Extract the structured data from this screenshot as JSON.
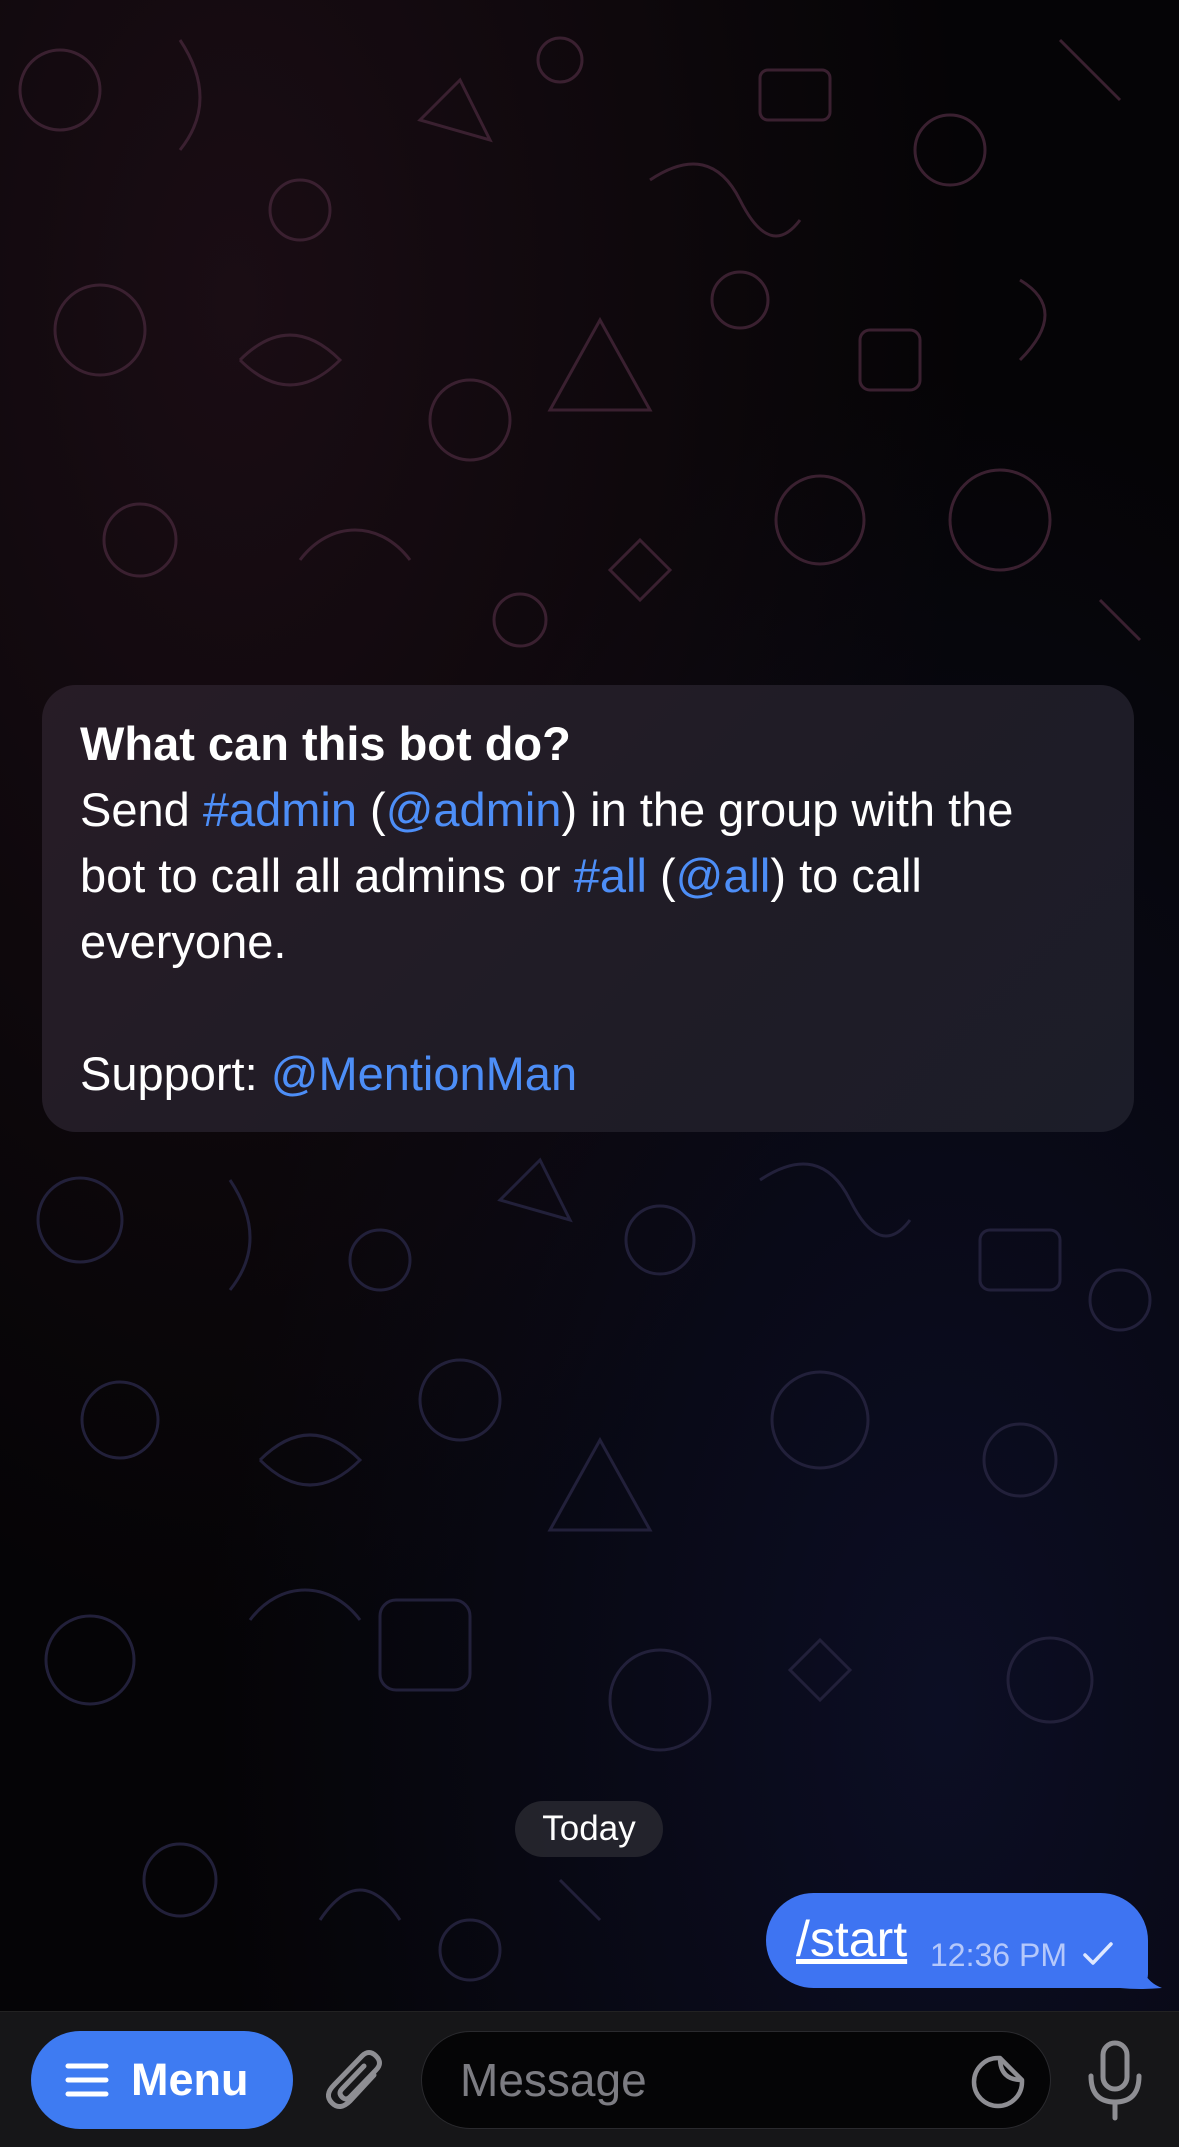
{
  "info_card": {
    "title": "What can this bot do?",
    "line1": {
      "t1": "Send ",
      "l1": "#admin",
      "t2": " (",
      "l2": "@admin",
      "t3": ") in the group with the"
    },
    "line2": {
      "t1": "bot to call all admins or ",
      "l1": "#all",
      "t2": " (",
      "l2": "@all",
      "t3": ") to call"
    },
    "line3": "everyone.",
    "support_label": "Support: ",
    "support_link": "@MentionMan"
  },
  "date_separator": "Today",
  "outgoing_message": {
    "text": "/start",
    "time": "12:36 PM"
  },
  "input_bar": {
    "menu_label": "Menu",
    "placeholder": "Message"
  },
  "colors": {
    "accent": "#3e7bf2",
    "link": "#4d8ef7",
    "outgoing_bubble": "#3e74f2"
  },
  "icons": {
    "menu": "hamburger-icon",
    "attach": "paperclip-icon",
    "sticker": "sticker-icon",
    "mic": "microphone-icon",
    "read": "check-icon"
  }
}
